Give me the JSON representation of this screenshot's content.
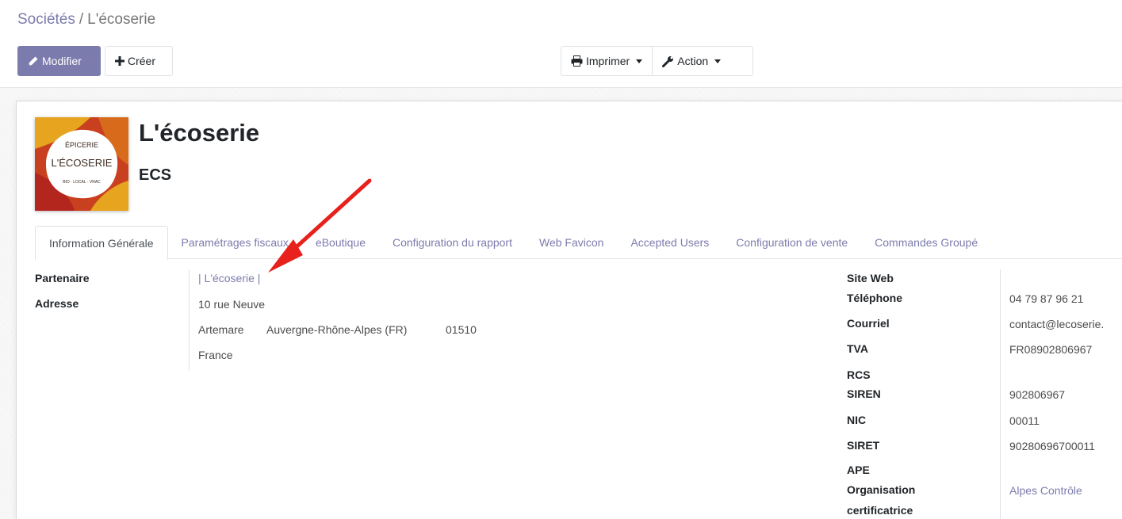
{
  "breadcrumb": {
    "parent": "Sociétés",
    "separator": "/",
    "current": "L'écoserie"
  },
  "toolbar": {
    "edit_label": "Modifier",
    "create_label": "Créer",
    "print_label": "Imprimer",
    "action_label": "Action"
  },
  "record": {
    "name": "L'écoserie",
    "code": "ECS",
    "logo": {
      "line1": "ÉPICERIE",
      "line2": "L'ÉCOSERIE",
      "line3": "BIO · LOCAL · VRAC",
      "colors": [
        "#e7a51f",
        "#c8401f",
        "#b3261e",
        "#d86a1c"
      ]
    }
  },
  "tabs": [
    {
      "label": "Information Générale",
      "active": true
    },
    {
      "label": "Paramétrages fiscaux",
      "active": false
    },
    {
      "label": "eBoutique",
      "active": false
    },
    {
      "label": "Configuration du rapport",
      "active": false
    },
    {
      "label": "Web Favicon",
      "active": false
    },
    {
      "label": "Accepted Users",
      "active": false
    },
    {
      "label": "Configuration de vente",
      "active": false
    },
    {
      "label": "Commandes Groupé",
      "active": false
    }
  ],
  "left_fields": {
    "partner_label": "Partenaire",
    "partner_value": "| L'écoserie |",
    "address_label": "Adresse",
    "street": "10 rue Neuve",
    "city": "Artemare",
    "state": "Auvergne-Rhône-Alpes (FR)",
    "zip": "01510",
    "country": "France"
  },
  "right_fields": [
    {
      "label": "Site Web",
      "value": ""
    },
    {
      "label": "Téléphone",
      "value": "04 79 87 96 21"
    },
    {
      "label": "Courriel",
      "value": "contact@lecoserie."
    },
    {
      "label": "TVA",
      "value": "FR08902806967"
    },
    {
      "label": "RCS",
      "value": ""
    },
    {
      "label": "SIREN",
      "value": "902806967"
    },
    {
      "label": "NIC",
      "value": "00011"
    },
    {
      "label": "SIRET",
      "value": "90280696700011"
    },
    {
      "label": "APE",
      "value": ""
    },
    {
      "label": "Organisation certificatrice",
      "label_line1": "Organisation",
      "label_line2": "certificatrice",
      "value": "Alpes Contrôle"
    }
  ],
  "colors": {
    "accent": "#7c7bad",
    "annotation_arrow": "#e8211c"
  }
}
